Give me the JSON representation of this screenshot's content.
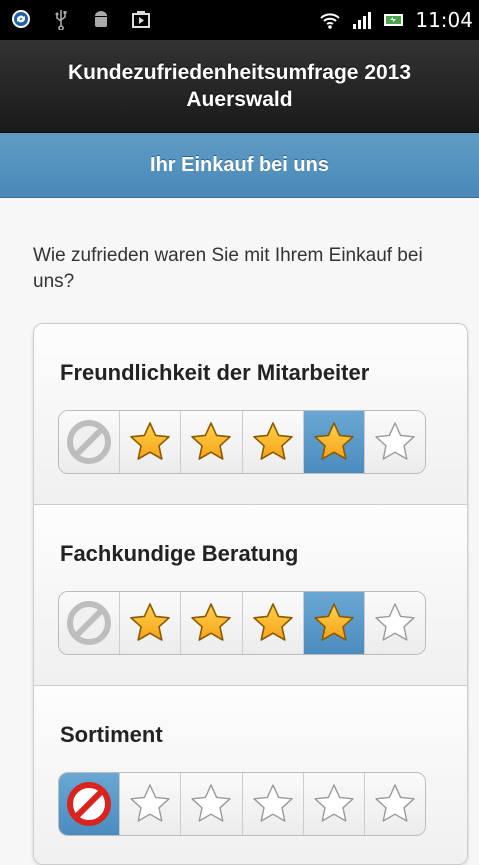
{
  "status_bar": {
    "time": "11:04",
    "left_icons": [
      "sync-icon",
      "usb-icon",
      "android-debug-icon",
      "play-store-icon"
    ],
    "right_icons": [
      "wifi-icon",
      "signal-icon",
      "battery-icon"
    ]
  },
  "header": {
    "title_line1": "Kundezufriedenheitsumfrage 2013",
    "title_line2": "Auerswald"
  },
  "section": {
    "title": "Ihr Einkauf bei uns"
  },
  "question": "Wie zufrieden waren Sie mit Ihrem Einkauf bei uns?",
  "items": [
    {
      "label": "Freundlichkeit der Mitarbeiter",
      "rating": 4,
      "max": 5
    },
    {
      "label": "Fachkundige Beratung",
      "rating": 4,
      "max": 5
    },
    {
      "label": "Sortiment",
      "rating": 0,
      "max": 5
    }
  ],
  "colors": {
    "accent": "#4b8cc0",
    "star_fill": "#f7a21b",
    "cancel_red": "#d9231d"
  }
}
